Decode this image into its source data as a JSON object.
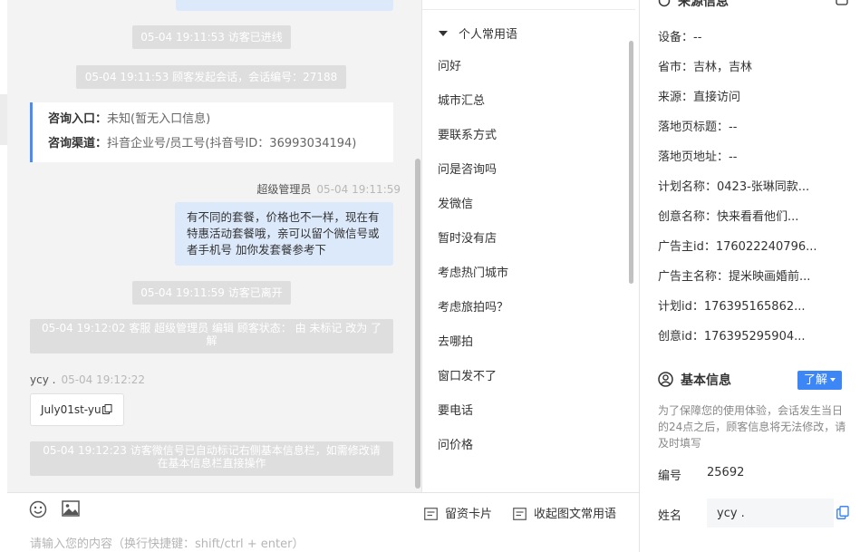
{
  "chat": {
    "messages": {
      "sys_entered": "05-04 19:11:53 访客已进线",
      "sys_session": "05-04 19:11:53 顾客发起会话，会话编号：27188",
      "entry_key": "咨询入口：",
      "entry_val": "未知(暂无入口信息)",
      "channel_key": "咨询渠道：",
      "channel_val": "抖音企业号/员工号(抖音号ID：36993034194)",
      "agent_name": "超级管理员",
      "agent_time": "05-04 19:11:59",
      "agent_text": "有不同的套餐，价格也不一样，现在有特惠活动套餐哦，亲可以留个微信号或者手机号 加你发套餐参考下",
      "sys_left": "05-04 19:11:59 访客已离开",
      "sys_status": "05-04 19:12:02 客服 超级管理员 编辑 顾客状态： 由 未标记 改为 了解",
      "visitor_name": "ycy .",
      "visitor_time": "05-04 19:12:22",
      "visitor_text": "July01st-yu",
      "sys_wechat": "05-04 19:12:23 访客微信号已自动标记右侧基本信息栏，如需修改请在基本信息栏直接操作"
    }
  },
  "phrases": {
    "header": "个人常用语",
    "items": [
      "问好",
      "城市汇总",
      "要联系方式",
      "问是咨询吗",
      "发微信",
      "暂时没有店",
      "考虑热门城市",
      "考虑旅拍吗？",
      "去哪拍",
      "窗口发不了",
      "要电话",
      "问价格"
    ]
  },
  "composer": {
    "emoji_icon": "smiley-icon",
    "image_icon": "image-icon",
    "card_btn": "留资卡片",
    "collect_btn": "收起图文常用语",
    "placeholder": "请输入您的内容（换行快捷键：shift/ctrl + enter）"
  },
  "info": {
    "source_title": "来源信息",
    "rows": [
      "设备：--",
      "省市：吉林，吉林",
      "来源：直接访问",
      "落地页标题：--",
      "落地页地址：--",
      "计划名称：0423-张琳同款...",
      "创意名称：快来看看他们...",
      "广告主id：176022240796...",
      "广告主名称：提米映画婚前...",
      "计划id：176395165862...",
      "创意id：176395295904..."
    ],
    "basic_title": "基本信息",
    "learn_btn": "了解",
    "notice": "为了保障您的使用体验，会话发生当日的24点之后，顾客信息将无法修改，请及时填写",
    "id_label": "编号",
    "id_value": "25692",
    "name_label": "姓名",
    "name_value": "ycy .",
    "accent": "#3c87f5"
  }
}
